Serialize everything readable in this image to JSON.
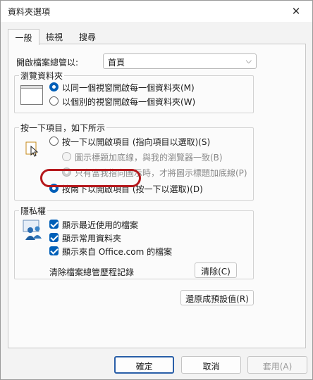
{
  "window": {
    "title": "資料夾選項",
    "close_icon": "close-icon"
  },
  "tabs": [
    {
      "label": "一般",
      "active": true
    },
    {
      "label": "檢視",
      "active": false
    },
    {
      "label": "搜尋",
      "active": false
    }
  ],
  "general": {
    "open_explorer_label": "開啟檔案總管以:",
    "open_explorer_value": "首頁",
    "browse": {
      "title": "瀏覽資料夾",
      "option_same": "以同一個視窗開啟每一個資料夾(M)",
      "option_own": "以個別的視窗開啟每一個資料夾(W)",
      "selected": "same"
    },
    "click": {
      "title": "按一下項目，如下所示",
      "option_single": "按一下以開啟項目 (指向項目以選取)(S)",
      "sub_browser": "圖示標題加底線，與我的瀏覽器一致(B)",
      "sub_point": "只有當我指向圖示時，才將圖示標題加底線(P)",
      "option_double": "按兩下以開啟項目 (按一下以選取)(D)",
      "selected": "double"
    },
    "privacy": {
      "title": "隱私權",
      "show_recent_files": "顯示最近使用的檔案",
      "show_frequent_folders": "顯示常用資料夾",
      "show_office": "顯示來自 Office.com 的檔案",
      "clear_label": "清除檔案總管歷程記錄",
      "clear_button": "清除(C)"
    },
    "restore_defaults": "還原成預設值(R)"
  },
  "footer": {
    "ok": "確定",
    "cancel": "取消",
    "apply": "套用(A)"
  },
  "colors": {
    "accent": "#005fb8",
    "highlight_ring": "#b5181c"
  }
}
